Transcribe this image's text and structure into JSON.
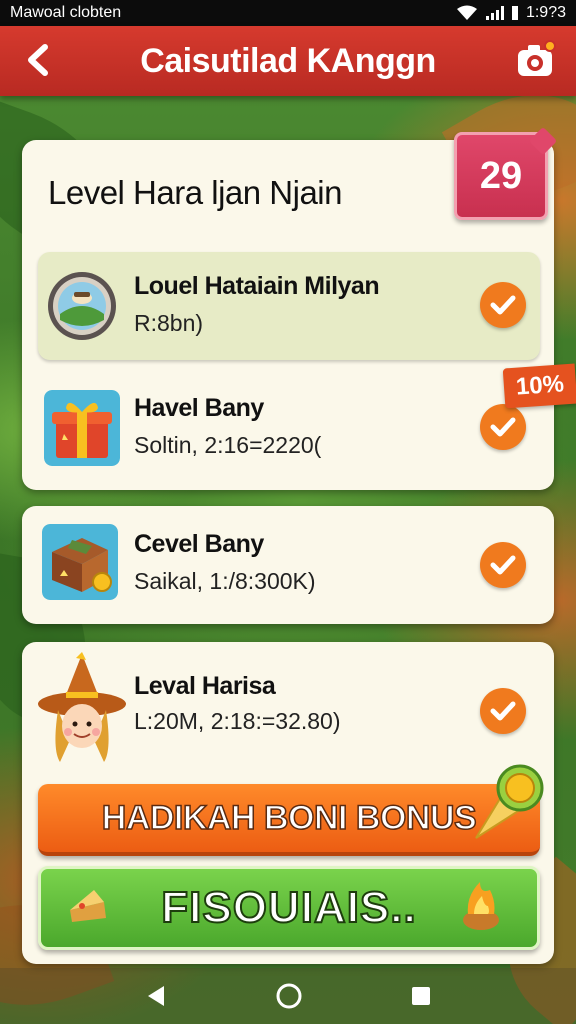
{
  "status_bar": {
    "carrier": "Mawoal clobten",
    "time": "1:9?3"
  },
  "app_bar": {
    "title": "Caisutilad KAnggn"
  },
  "card": {
    "title": "Level Hara ljan Njain",
    "date_badge": "29"
  },
  "discount_tag": "10%",
  "rewards": [
    {
      "title": "Louel Hataiain Milyan",
      "subtitle": "R:8bn)",
      "icon": "medal-coin-icon",
      "checked": true
    },
    {
      "title": "Havel Bany",
      "subtitle": "Soltin, 2:16=2220(",
      "icon": "gift-box-icon",
      "checked": true
    },
    {
      "title": "Cevel Bany",
      "subtitle": "Saikal, 1:/8:300K)",
      "icon": "treasure-box-icon",
      "checked": true
    },
    {
      "title": "Leval Harisa",
      "subtitle": "L:20M, 2:18:=32.80)",
      "icon": "witch-avatar-icon",
      "checked": true
    }
  ],
  "buttons": {
    "bonus": "HADIKAH BONI BONUS",
    "claim": "FISOUIAIS.."
  },
  "colors": {
    "app_bar": "#c8302a",
    "check": "#f07a1e",
    "bonus_button": "#f36a1a",
    "claim_button": "#5dbb36",
    "card": "#fbf8ea"
  }
}
